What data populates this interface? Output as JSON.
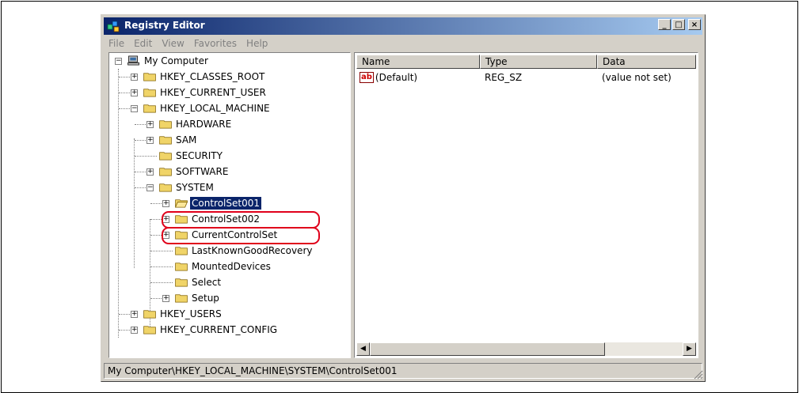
{
  "window": {
    "title": "Registry Editor",
    "min_glyph": "_",
    "max_glyph": "□",
    "close_glyph": "×"
  },
  "menu": [
    "File",
    "Edit",
    "View",
    "Favorites",
    "Help"
  ],
  "tree": {
    "root": "My Computer",
    "hkcr": "HKEY_CLASSES_ROOT",
    "hkcu": "HKEY_CURRENT_USER",
    "hklm": "HKEY_LOCAL_MACHINE",
    "hardware": "HARDWARE",
    "sam": "SAM",
    "security": "SECURITY",
    "software": "SOFTWARE",
    "system": "SYSTEM",
    "cs001": "ControlSet001",
    "cs002": "ControlSet002",
    "ccs": "CurrentControlSet",
    "lkgr": "LastKnownGoodRecovery",
    "mounted": "MountedDevices",
    "select": "Select",
    "setup": "Setup",
    "hku": "HKEY_USERS",
    "hkcc": "HKEY_CURRENT_CONFIG"
  },
  "list": {
    "columns": [
      "Name",
      "Type",
      "Data"
    ],
    "rows": [
      {
        "name": "(Default)",
        "type": "REG_SZ",
        "data": "(value not set)"
      }
    ],
    "value_icon_text": "ab"
  },
  "status": "My Computer\\HKEY_LOCAL_MACHINE\\SYSTEM\\ControlSet001",
  "colors": {
    "title_start": "#0a246a",
    "title_end": "#a6caf0",
    "highlight_ring": "#e0001b",
    "folder": "#f0d468"
  }
}
